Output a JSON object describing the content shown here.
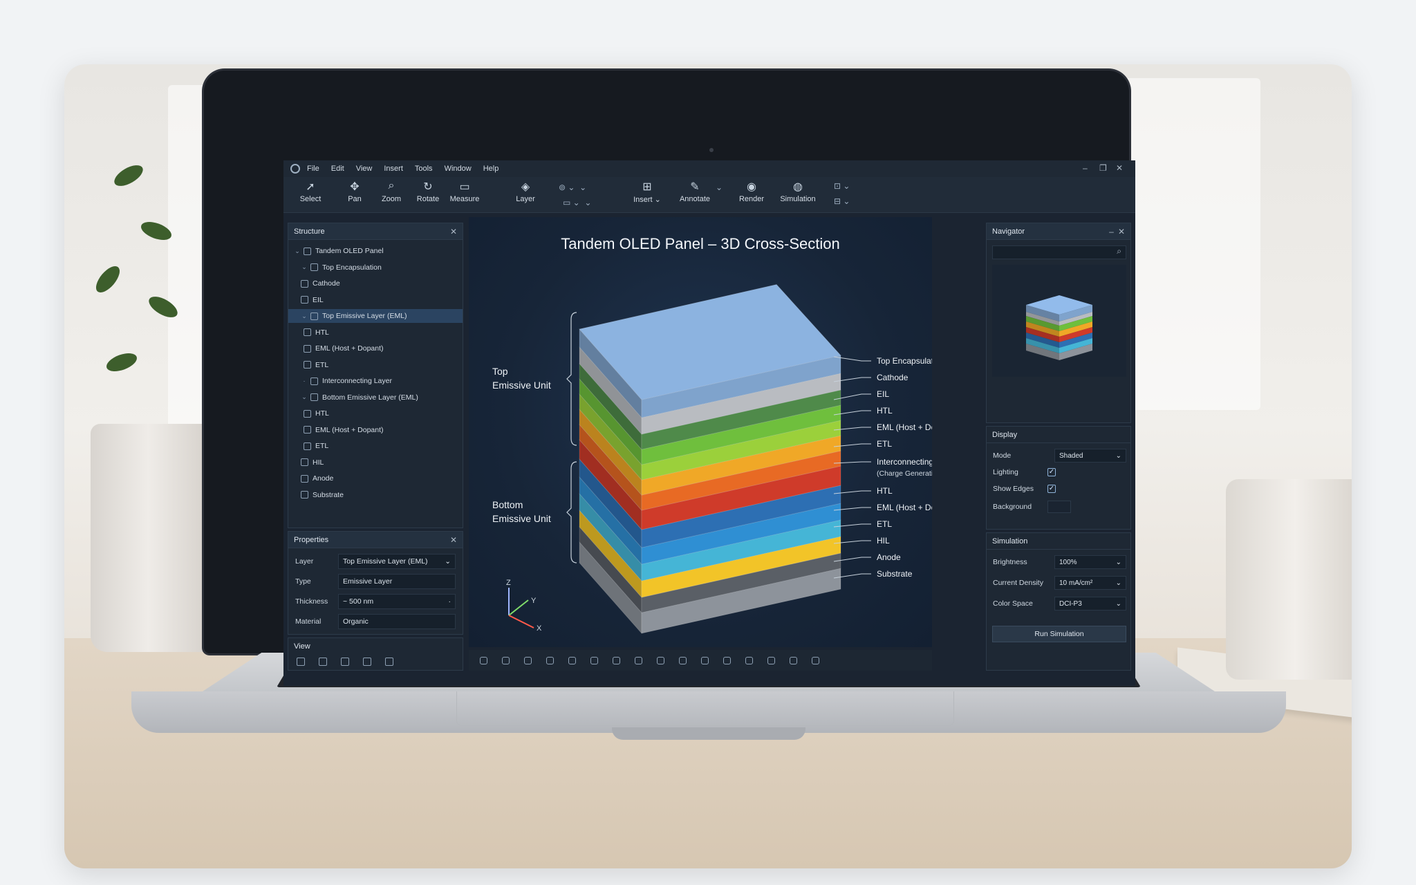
{
  "menu": [
    "File",
    "Edit",
    "View",
    "Insert",
    "Tools",
    "Window",
    "Help"
  ],
  "window_controls": [
    "–",
    "❐",
    "✕"
  ],
  "toolbar": {
    "tools": [
      {
        "label": "Select",
        "icon": "cursor-icon"
      },
      {
        "label": "Pan",
        "icon": "hand-icon"
      },
      {
        "label": "Zoom",
        "icon": "magnifier-icon"
      },
      {
        "label": "Rotate",
        "icon": "rotate-icon"
      },
      {
        "label": "Measure",
        "icon": "ruler-icon"
      },
      {
        "label": "Layer",
        "icon": "layers-icon"
      },
      {
        "label": "Insert ⌄",
        "icon": "insert-icon"
      },
      {
        "label": "Annotate",
        "icon": "annotate-icon"
      },
      {
        "label": "Render",
        "icon": "render-icon"
      },
      {
        "label": "Simulation",
        "icon": "simulation-icon"
      }
    ]
  },
  "structure": {
    "title": "Structure",
    "items": [
      {
        "label": "Tandem OLED Panel",
        "toggle": "⌄"
      },
      {
        "label": "Top Encapsulation",
        "toggle": "⌄"
      },
      {
        "label": "Cathode",
        "toggle": ""
      },
      {
        "label": "EIL",
        "toggle": ""
      },
      {
        "label": "Top Emissive Layer (EML)",
        "toggle": "⌄",
        "selected": true
      },
      {
        "label": "HTL",
        "toggle": ""
      },
      {
        "label": "EML (Host + Dopant)",
        "toggle": ""
      },
      {
        "label": "ETL",
        "toggle": ""
      },
      {
        "label": "Interconnecting Layer",
        "toggle": "·"
      },
      {
        "label": "Bottom Emissive Layer (EML)",
        "toggle": "⌄"
      },
      {
        "label": "HTL",
        "toggle": ""
      },
      {
        "label": "EML (Host + Dopant)",
        "toggle": ""
      },
      {
        "label": "ETL",
        "toggle": ""
      },
      {
        "label": "HIL",
        "toggle": ""
      },
      {
        "label": "Anode",
        "toggle": ""
      },
      {
        "label": "Substrate",
        "toggle": ""
      }
    ]
  },
  "properties": {
    "title": "Properties",
    "rows": [
      {
        "label": "Layer",
        "value": "Top Emissive Layer (EML)",
        "dropdown": "⌄"
      },
      {
        "label": "Type",
        "value": "Emissive Layer",
        "dropdown": ""
      },
      {
        "label": "Thickness",
        "value": "~ 500 nm",
        "dropdown": "·"
      },
      {
        "label": "Material",
        "value": "Organic",
        "dropdown": ""
      }
    ]
  },
  "view_panel": {
    "title": "View"
  },
  "viewport": {
    "title": "Tandem OLED Panel – 3D Cross-Section",
    "brace_top": [
      "Top",
      "Emissive Unit"
    ],
    "brace_bottom": [
      "Bottom",
      "Emissive Unit"
    ],
    "callouts": [
      {
        "label": "Top Encapsulation",
        "sub": ""
      },
      {
        "label": "Cathode",
        "sub": ""
      },
      {
        "label": "EIL",
        "sub": ""
      },
      {
        "label": "HTL",
        "sub": ""
      },
      {
        "label": "EML (Host + Dopant)",
        "sub": ""
      },
      {
        "label": "ETL",
        "sub": ""
      },
      {
        "label": "Interconnecting Layer",
        "sub": "(Charge Generation Layer)"
      },
      {
        "label": "HTL",
        "sub": ""
      },
      {
        "label": "EML (Host + Dopant)",
        "sub": ""
      },
      {
        "label": "ETL",
        "sub": ""
      },
      {
        "label": "HIL",
        "sub": ""
      },
      {
        "label": "Anode",
        "sub": ""
      },
      {
        "label": "Substrate",
        "sub": ""
      }
    ],
    "layer_colors": [
      "#7fa3cc",
      "#b9bcc1",
      "#4f8a4a",
      "#6fbf3d",
      "#9bd03b",
      "#f0a827",
      "#e86a24",
      "#cf3b2a",
      "#2d6fb3",
      "#2f8fd3",
      "#45b5d6",
      "#f2c428",
      "#5a5f66",
      "#8d939b"
    ],
    "axes": [
      "Z",
      "Y",
      "X"
    ]
  },
  "navigator": {
    "title": "Navigator",
    "controls": [
      "–",
      "✕"
    ]
  },
  "display": {
    "title": "Display",
    "mode_label": "Mode",
    "mode_value": "Shaded",
    "lighting_label": "Lighting",
    "lighting_checked": "✓",
    "edges_label": "Show Edges",
    "edges_checked": "✓",
    "background_label": "Background"
  },
  "simulation": {
    "title": "Simulation",
    "brightness_label": "Brightness",
    "brightness_value": "100%",
    "density_label": "Current Density",
    "density_value": "10 mA/cm²",
    "colorspace_label": "Color Space",
    "colorspace_value": "DCI-P3",
    "run_label": "Run Simulation"
  }
}
